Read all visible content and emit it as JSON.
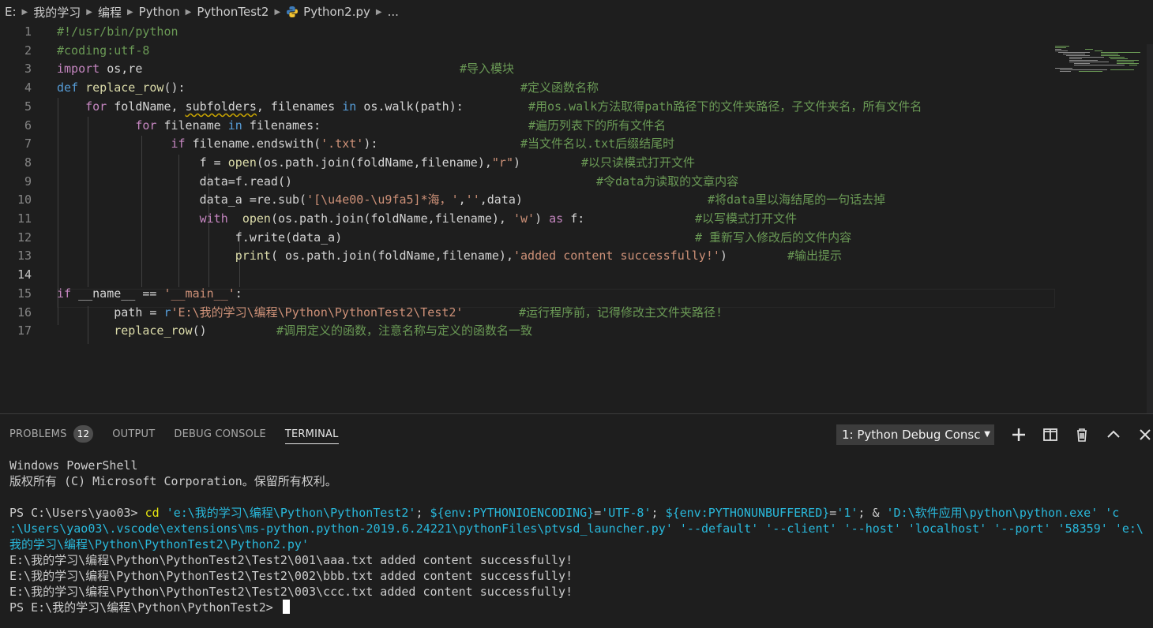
{
  "breadcrumb": [
    "E:",
    "我的学习",
    "编程",
    "Python",
    "PythonTest2",
    "Python2.py",
    "..."
  ],
  "editor": {
    "lines": [
      {
        "n": "1",
        "tokens": [
          {
            "t": "#!/usr/bin/python",
            "c": "com"
          }
        ],
        "comment": ""
      },
      {
        "n": "2",
        "tokens": [
          {
            "t": "#coding:utf-8",
            "c": "com"
          }
        ],
        "comment": ""
      },
      {
        "n": "3",
        "tokens": [
          {
            "t": "import",
            "c": "ctl"
          },
          {
            "t": " os,re",
            "c": "pl"
          }
        ],
        "comment": "#导入模块"
      },
      {
        "n": "4",
        "tokens": [
          {
            "t": "def",
            "c": "kw"
          },
          {
            "t": " ",
            "c": "pl"
          },
          {
            "t": "replace_row",
            "c": "fn"
          },
          {
            "t": "():",
            "c": "pl"
          }
        ],
        "comment": "#定义函数名称"
      },
      {
        "n": "5",
        "tokens": [
          {
            "t": "    ",
            "c": "pl"
          },
          {
            "t": "for",
            "c": "ctl"
          },
          {
            "t": " foldName, ",
            "c": "pl"
          },
          {
            "t": "subfolders",
            "c": "pl",
            "squig": true
          },
          {
            "t": ", filenames ",
            "c": "pl"
          },
          {
            "t": "in",
            "c": "kw"
          },
          {
            "t": " os.walk(path):",
            "c": "pl"
          }
        ],
        "comment": "#用os.walk方法取得path路径下的文件夹路径，子文件夹名，所有文件名"
      },
      {
        "n": "6",
        "tokens": [
          {
            "t": "           ",
            "c": "pl"
          },
          {
            "t": "for",
            "c": "ctl"
          },
          {
            "t": " filename ",
            "c": "pl"
          },
          {
            "t": "in",
            "c": "kw"
          },
          {
            "t": " filenames:",
            "c": "pl"
          }
        ],
        "comment": "#遍历列表下的所有文件名"
      },
      {
        "n": "7",
        "tokens": [
          {
            "t": "                ",
            "c": "pl"
          },
          {
            "t": "if",
            "c": "ctl"
          },
          {
            "t": " filename.endswith(",
            "c": "pl"
          },
          {
            "t": "'.txt'",
            "c": "str"
          },
          {
            "t": "):",
            "c": "pl"
          }
        ],
        "comment": "#当文件名以.txt后缀结尾时"
      },
      {
        "n": "8",
        "tokens": [
          {
            "t": "                    f = ",
            "c": "pl"
          },
          {
            "t": "open",
            "c": "fn"
          },
          {
            "t": "(os.path.join(foldName,filename),",
            "c": "pl"
          },
          {
            "t": "\"r\"",
            "c": "str"
          },
          {
            "t": ")",
            "c": "pl"
          }
        ],
        "comment": "#以只读模式打开文件"
      },
      {
        "n": "9",
        "tokens": [
          {
            "t": "                    data=f.read()",
            "c": "pl"
          }
        ],
        "comment": "#令data为读取的文章内容"
      },
      {
        "n": "10",
        "tokens": [
          {
            "t": "                    data_a =re.sub(",
            "c": "pl"
          },
          {
            "t": "'[\\u4e00-\\u9fa5]*海，'",
            "c": "str"
          },
          {
            "t": ",",
            "c": "pl"
          },
          {
            "t": "''",
            "c": "str"
          },
          {
            "t": ",data)",
            "c": "pl"
          }
        ],
        "comment": "#将data里以海结尾的一句话去掉"
      },
      {
        "n": "11",
        "tokens": [
          {
            "t": "                    ",
            "c": "pl"
          },
          {
            "t": "with",
            "c": "ctl"
          },
          {
            "t": "  ",
            "c": "pl"
          },
          {
            "t": "open",
            "c": "fn"
          },
          {
            "t": "(os.path.join(foldName,filename), ",
            "c": "pl"
          },
          {
            "t": "'w'",
            "c": "str"
          },
          {
            "t": ") ",
            "c": "pl"
          },
          {
            "t": "as",
            "c": "ctl"
          },
          {
            "t": " f:",
            "c": "pl"
          }
        ],
        "comment": "#以写模式打开文件"
      },
      {
        "n": "12",
        "tokens": [
          {
            "t": "                         f.write(data_a)",
            "c": "pl"
          }
        ],
        "comment": "# 重新写入修改后的文件内容"
      },
      {
        "n": "13",
        "tokens": [
          {
            "t": "                         ",
            "c": "pl"
          },
          {
            "t": "print",
            "c": "fn"
          },
          {
            "t": "( os.path.join(foldName,filename),",
            "c": "pl"
          },
          {
            "t": "'added content successfully!'",
            "c": "str"
          },
          {
            "t": ")",
            "c": "pl"
          }
        ],
        "comment": "#输出提示"
      },
      {
        "n": "14",
        "tokens": [],
        "comment": ""
      },
      {
        "n": "15",
        "tokens": [
          {
            "t": "if",
            "c": "ctl"
          },
          {
            "t": " __name__ == ",
            "c": "pl"
          },
          {
            "t": "'__main__'",
            "c": "str"
          },
          {
            "t": ":",
            "c": "pl"
          }
        ],
        "comment": ""
      },
      {
        "n": "16",
        "tokens": [
          {
            "t": "        path = ",
            "c": "pl"
          },
          {
            "t": "r",
            "c": "kw"
          },
          {
            "t": "'E:\\我的学习\\编程\\Python\\PythonTest2\\Test2'",
            "c": "str"
          }
        ],
        "comment": "#运行程序前，记得修改主文件夹路径!"
      },
      {
        "n": "17",
        "tokens": [
          {
            "t": "        ",
            "c": "pl"
          },
          {
            "t": "replace_row",
            "c": "fn"
          },
          {
            "t": "()",
            "c": "pl"
          }
        ],
        "comment": "#调用定义的函数，注意名称与定义的函数名一致"
      }
    ]
  },
  "panel": {
    "tabs": [
      {
        "label": "PROBLEMS",
        "badge": "12",
        "active": false
      },
      {
        "label": "OUTPUT",
        "badge": "",
        "active": false
      },
      {
        "label": "DEBUG CONSOLE",
        "badge": "",
        "active": false
      },
      {
        "label": "TERMINAL",
        "badge": "",
        "active": true
      }
    ],
    "terminal_selector": "1: Python Debug Consc",
    "icons": [
      "plus-icon",
      "split-icon",
      "trash-icon",
      "chevron-up-icon",
      "close-icon"
    ]
  },
  "terminal": {
    "lines": [
      {
        "segments": [
          {
            "t": "Windows PowerShell",
            "c": ""
          }
        ]
      },
      {
        "segments": [
          {
            "t": "版权所有 (C) Microsoft Corporation。保留所有权利。",
            "c": ""
          }
        ]
      },
      {
        "segments": []
      },
      {
        "segments": [
          {
            "t": "PS C:\\Users\\yao03> ",
            "c": ""
          },
          {
            "t": "cd",
            "c": "tcmd"
          },
          {
            "t": " ",
            "c": ""
          },
          {
            "t": "'e:\\我的学习\\编程\\Python\\PythonTest2'",
            "c": "tstr"
          },
          {
            "t": "; ",
            "c": ""
          },
          {
            "t": "${env:PYTHONIOENCODING}",
            "c": "tvar"
          },
          {
            "t": "=",
            "c": ""
          },
          {
            "t": "'UTF-8'",
            "c": "tstr"
          },
          {
            "t": "; ",
            "c": ""
          },
          {
            "t": "${env:PYTHONUNBUFFERED}",
            "c": "tvar"
          },
          {
            "t": "=",
            "c": ""
          },
          {
            "t": "'1'",
            "c": "tstr"
          },
          {
            "t": "; & ",
            "c": ""
          },
          {
            "t": "'D:\\软件应用\\python\\python.exe'",
            "c": "tstr"
          },
          {
            "t": " ",
            "c": ""
          },
          {
            "t": "'c",
            "c": "tstr"
          }
        ]
      },
      {
        "segments": [
          {
            "t": ":\\Users\\yao03\\.vscode\\extensions\\ms-python.python-2019.6.24221\\pythonFiles\\ptvsd_launcher.py'",
            "c": "tstr"
          },
          {
            "t": " ",
            "c": ""
          },
          {
            "t": "'--default'",
            "c": "tstr"
          },
          {
            "t": " ",
            "c": ""
          },
          {
            "t": "'--client'",
            "c": "tstr"
          },
          {
            "t": " ",
            "c": ""
          },
          {
            "t": "'--host'",
            "c": "tstr"
          },
          {
            "t": " ",
            "c": ""
          },
          {
            "t": "'localhost'",
            "c": "tstr"
          },
          {
            "t": " ",
            "c": ""
          },
          {
            "t": "'--port'",
            "c": "tstr"
          },
          {
            "t": " ",
            "c": ""
          },
          {
            "t": "'58359'",
            "c": "tstr"
          },
          {
            "t": " ",
            "c": ""
          },
          {
            "t": "'e:\\",
            "c": "tstr"
          }
        ]
      },
      {
        "segments": [
          {
            "t": "我的学习\\编程\\Python\\PythonTest2\\Python2.py'",
            "c": "tstr"
          }
        ]
      },
      {
        "segments": [
          {
            "t": "E:\\我的学习\\编程\\Python\\PythonTest2\\Test2\\001\\aaa.txt added content successfully!",
            "c": ""
          }
        ]
      },
      {
        "segments": [
          {
            "t": "E:\\我的学习\\编程\\Python\\PythonTest2\\Test2\\002\\bbb.txt added content successfully!",
            "c": ""
          }
        ]
      },
      {
        "segments": [
          {
            "t": "E:\\我的学习\\编程\\Python\\PythonTest2\\Test2\\003\\ccc.txt added content successfully!",
            "c": ""
          }
        ]
      },
      {
        "segments": [
          {
            "t": "PS E:\\我的学习\\编程\\Python\\PythonTest2> ",
            "c": ""
          }
        ],
        "cursor": true
      }
    ]
  },
  "colors": {
    "background": "#1e1e1e",
    "keyword": "#569cd6",
    "control": "#c586c0",
    "string": "#ce9178",
    "comment": "#6a9955",
    "function": "#dcdcaa",
    "terminal_string": "#29b8db",
    "terminal_command": "#e5e510"
  }
}
